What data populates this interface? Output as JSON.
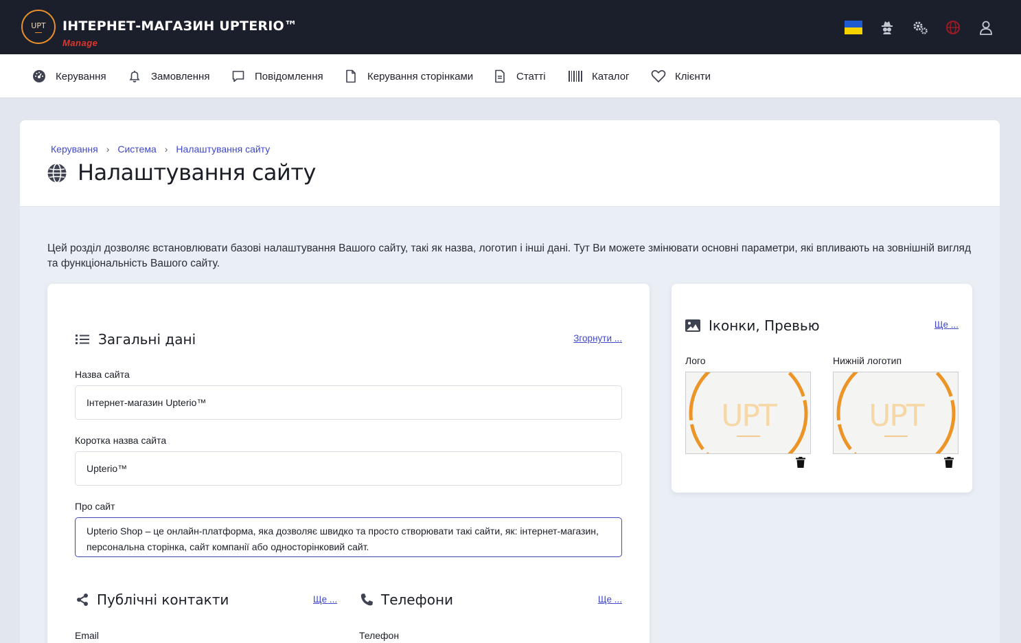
{
  "header": {
    "logo_text": "UPT",
    "brand_title": "ІНТЕРНЕТ-МАГАЗИН UPTERIO™",
    "brand_subtitle": "Manage",
    "icons": [
      "ukraine-flag-icon",
      "incognito-icon",
      "settings-gears-icon",
      "globe-icon",
      "user-icon"
    ],
    "accent_color": "#e8902b",
    "brand_sub_color": "#e2352b"
  },
  "nav": {
    "items": [
      {
        "label": "Керування",
        "icon": "dashboard-icon"
      },
      {
        "label": "Замовлення",
        "icon": "bell-icon"
      },
      {
        "label": "Повідомлення",
        "icon": "message-icon"
      },
      {
        "label": "Керування сторінками",
        "icon": "page-icon"
      },
      {
        "label": "Статті",
        "icon": "article-icon"
      },
      {
        "label": "Каталог",
        "icon": "barcode-icon"
      },
      {
        "label": "Клієнти",
        "icon": "heart-icon"
      }
    ]
  },
  "breadcrumbs": [
    "Керування",
    "Система",
    "Налаштування сайту"
  ],
  "page": {
    "title": "Налаштування сайту",
    "intro": "Цей розділ дозволяє встановлювати базові налаштування Вашого сайту, такі як назва, логотип і інші дані. Тут Ви можете змінювати основні параметри, які впливають на зовнішній вигляд та функціональність Вашого сайту."
  },
  "general": {
    "title": "Загальні дані",
    "collapse_link": "Згорнути ...",
    "site_name_label": "Назва сайта",
    "site_name_value": "Інтернет-магазин Upterio™",
    "short_name_label": "Коротка назва сайта",
    "short_name_value": "Upterio™",
    "about_label": "Про сайт",
    "about_value": "Upterio Shop – це онлайн-платформа, яка дозволяє швидко та просто створювати такі сайти, як: інтернет-магазин, персональна сторінка, сайт компанії або односторінковий сайт."
  },
  "contacts": {
    "title": "Публічні контакти",
    "more_link": "Ще ...",
    "email_label": "Email"
  },
  "phones": {
    "title": "Телефони",
    "more_link": "Ще ...",
    "phone_label": "Телефон"
  },
  "icons_card": {
    "title": "Іконки, Превью",
    "more_link": "Ще ...",
    "logo_label": "Лого",
    "footer_logo_label": "Нижній логотип",
    "thumb_text": "UPT"
  }
}
